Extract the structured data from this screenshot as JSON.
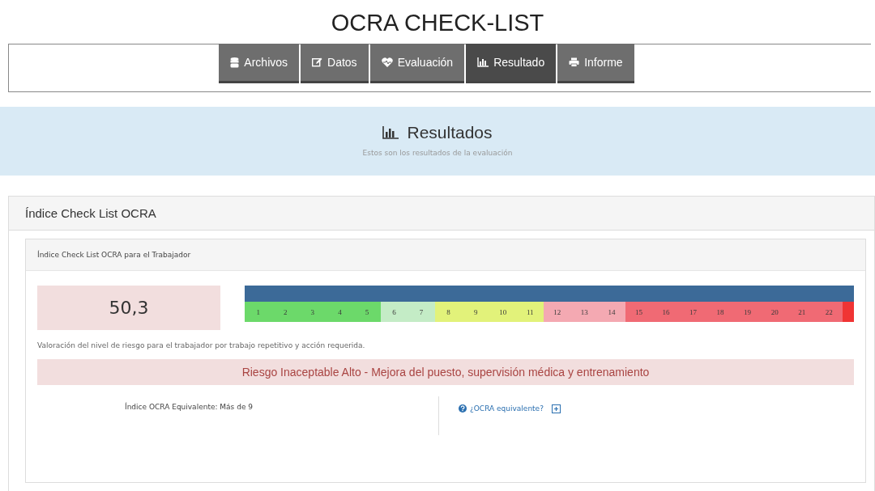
{
  "page_title": "OCRA CHECK-LIST",
  "tabs": [
    {
      "label": "Archivos",
      "selected": false
    },
    {
      "label": "Datos",
      "selected": false
    },
    {
      "label": "Evaluación",
      "selected": false
    },
    {
      "label": "Resultado",
      "selected": true
    },
    {
      "label": "Informe",
      "selected": false
    }
  ],
  "banner": {
    "title": "Resultados",
    "subtitle": "Estos son los resultados de la evaluación"
  },
  "panel": {
    "title": "Índice Check List OCRA",
    "subpanel_title": "Índice Check List OCRA para el Trabajador",
    "score": "50,3",
    "meter": {
      "level": 1
    },
    "scale": [
      {
        "label": "1",
        "color": "#6cd96a"
      },
      {
        "label": "2",
        "color": "#6cd96a"
      },
      {
        "label": "3",
        "color": "#6cd96a"
      },
      {
        "label": "4",
        "color": "#6cd96a"
      },
      {
        "label": "5",
        "color": "#6cd96a"
      },
      {
        "label": "6",
        "color": "#c4ecc6"
      },
      {
        "label": "7",
        "color": "#c4ecc6"
      },
      {
        "label": "8",
        "color": "#e2f27a"
      },
      {
        "label": "9",
        "color": "#e2f27a"
      },
      {
        "label": "10",
        "color": "#e2f27a"
      },
      {
        "label": "11",
        "color": "#e2f27a"
      },
      {
        "label": "12",
        "color": "#f4a9b2"
      },
      {
        "label": "13",
        "color": "#f4a9b2"
      },
      {
        "label": "14",
        "color": "#f4a9b2"
      },
      {
        "label": "15",
        "color": "#f06a74"
      },
      {
        "label": "16",
        "color": "#f06a74"
      },
      {
        "label": "17",
        "color": "#f06a74"
      },
      {
        "label": "18",
        "color": "#f06a74"
      },
      {
        "label": "19",
        "color": "#f06a74"
      },
      {
        "label": "20",
        "color": "#f06a74"
      },
      {
        "label": "21",
        "color": "#f06a74"
      },
      {
        "label": "22",
        "color": "#f06a74"
      }
    ],
    "description": "Valoración del nivel de riesgo para el trabajador por trabajo repetitivo y acción requerida.",
    "risk": "Riesgo Inaceptable Alto  -  Mejora del puesto, supervisión médica y entrenamiento",
    "equivalent": "Índice OCRA Equivalente: Más de 9",
    "help_link": "¿OCRA equivalente?"
  }
}
